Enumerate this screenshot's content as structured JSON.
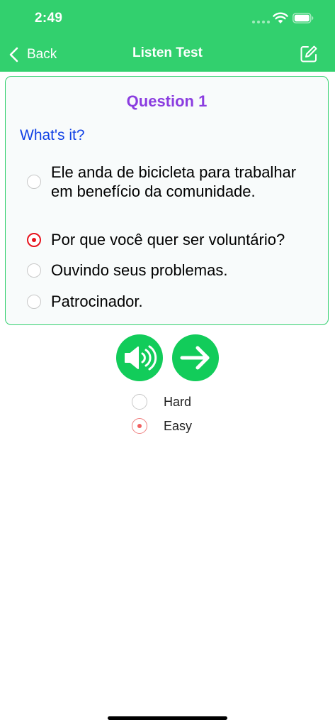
{
  "status_bar": {
    "time": "2:49"
  },
  "nav": {
    "back_label": "Back",
    "title": "Listen Test"
  },
  "question": {
    "title": "Question 1",
    "prompt": "What's it?",
    "options": [
      {
        "text": "Ele anda de bicicleta para trabalhar em benefício da comunidade.",
        "selected": false
      },
      {
        "text": "Por que você quer ser voluntário?",
        "selected": true
      },
      {
        "text": "Ouvindo seus problemas.",
        "selected": false
      },
      {
        "text": "Patrocinador.",
        "selected": false
      }
    ]
  },
  "difficulty": {
    "options": [
      {
        "label": "Hard",
        "selected": false
      },
      {
        "label": "Easy",
        "selected": true
      }
    ]
  },
  "colors": {
    "accent": "#32d06e",
    "button": "#12cc5a",
    "question_title": "#8b3de0",
    "prompt": "#1242e6",
    "selected_radio": "#e8141e"
  }
}
